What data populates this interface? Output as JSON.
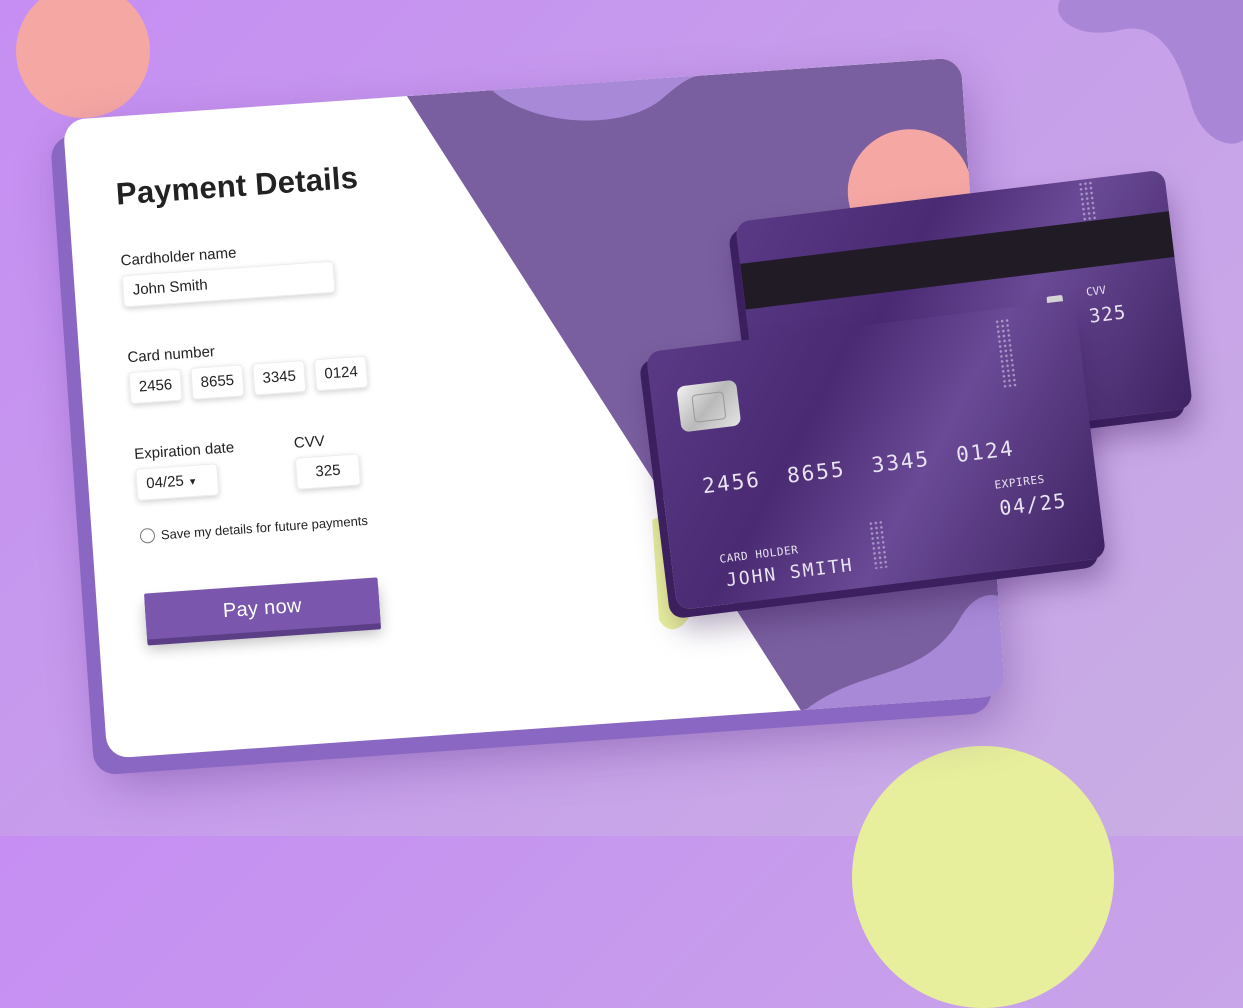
{
  "form": {
    "title": "Payment Details",
    "cardholder_label": "Cardholder name",
    "cardholder_value": "John Smith",
    "card_number_label": "Card number",
    "card_number_groups": [
      "2456",
      "8655",
      "3345",
      "0124"
    ],
    "expiration_label": "Expiration date",
    "expiration_value": "04/25",
    "expiration_arrow": "▾",
    "cvv_label": "CVV",
    "cvv_value": "325",
    "save_details_label": "Save my details for future payments",
    "pay_button_label": "Pay now"
  },
  "card_front": {
    "number": "2456 8655 3345 0124",
    "holder_label": "CARD HOLDER",
    "holder_name": "JOHN SMITH",
    "expires_label": "EXPIRES",
    "expires_value": "04/25"
  },
  "card_back": {
    "cvv_label": "CVV",
    "cvv_value": "325"
  },
  "colors": {
    "accent": "#7a57ad",
    "panel_purple": "#7a5fa0",
    "coral": "#f5a7a3",
    "yellow": "#e7ef9c",
    "background": "#c68ef3"
  }
}
